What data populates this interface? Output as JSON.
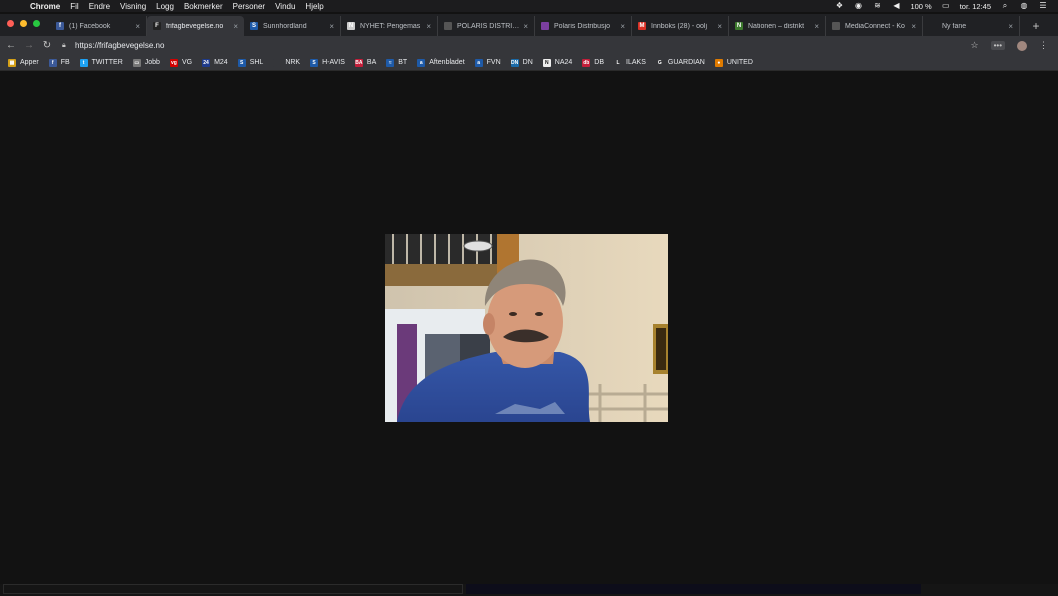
{
  "menubar": {
    "app": "Chrome",
    "items": [
      "Fil",
      "Endre",
      "Visning",
      "Logg",
      "Bokmerker",
      "Personer",
      "Vindu",
      "Hjelp"
    ],
    "battery": "100 %",
    "clock": "tor. 12:45"
  },
  "tabs": [
    {
      "title": "(1) Facebook",
      "favicon_color": "#3b5998",
      "glyph": "f",
      "active": false
    },
    {
      "title": "frifagbevegelse.no",
      "favicon_color": "#222222",
      "glyph": "F",
      "active": true
    },
    {
      "title": "Sunnhordland",
      "favicon_color": "#1e5aa8",
      "glyph": "S",
      "active": false
    },
    {
      "title": "NYHET: Pengemas",
      "favicon_color": "#cccccc",
      "glyph": "N",
      "active": false
    },
    {
      "title": "POLARIS DISTRIBU",
      "favicon_color": "#555555",
      "glyph": "",
      "active": false
    },
    {
      "title": "Polaris Distribusjo",
      "favicon_color": "#7b3fa0",
      "glyph": "",
      "active": false
    },
    {
      "title": "Innboks (28) - oolj",
      "favicon_color": "#d93025",
      "glyph": "M",
      "active": false
    },
    {
      "title": "Nationen – distrikt",
      "favicon_color": "#3d7a2e",
      "glyph": "N",
      "active": false
    },
    {
      "title": "MediaConnect - Ko",
      "favicon_color": "#555555",
      "glyph": "",
      "active": false
    },
    {
      "title": "Ny fane",
      "favicon_color": "",
      "glyph": "",
      "active": false
    }
  ],
  "toolbar": {
    "url": "https://frifagbevegelse.no"
  },
  "bookmarks": [
    {
      "label": "Apper",
      "color": "#d4a017",
      "glyph": "▦"
    },
    {
      "label": "FB",
      "color": "#3b5998",
      "glyph": "f"
    },
    {
      "label": "TWITTER",
      "color": "#1da1f2",
      "glyph": "t"
    },
    {
      "label": "Jobb",
      "color": "#777777",
      "glyph": "▭"
    },
    {
      "label": "VG",
      "color": "#d40000",
      "glyph": "vg"
    },
    {
      "label": "M24",
      "color": "#1e3a8a",
      "glyph": "24"
    },
    {
      "label": "SHL",
      "color": "#1e5aa8",
      "glyph": "S"
    },
    {
      "label": "NRK",
      "color": "#35363a",
      "glyph": ""
    },
    {
      "label": "H-AVIS",
      "color": "#1e5aa8",
      "glyph": "S"
    },
    {
      "label": "BA",
      "color": "#c41e3a",
      "glyph": "BA"
    },
    {
      "label": "BT",
      "color": "#1e5aa8",
      "glyph": "≈"
    },
    {
      "label": "Aftenbladet",
      "color": "#1e5aa8",
      "glyph": "a"
    },
    {
      "label": "FVN",
      "color": "#1e5aa8",
      "glyph": "a"
    },
    {
      "label": "DN",
      "color": "#1a6aa8",
      "glyph": "DN"
    },
    {
      "label": "NA24",
      "color": "#eeeeee",
      "glyph": "N"
    },
    {
      "label": "DB",
      "color": "#c41e3a",
      "glyph": "db"
    },
    {
      "label": "ILAKS",
      "color": "#35363a",
      "glyph": "L"
    },
    {
      "label": "GUARDIAN",
      "color": "#35363a",
      "glyph": "G"
    },
    {
      "label": "UNITED",
      "color": "#e07b00",
      "glyph": "●"
    }
  ]
}
